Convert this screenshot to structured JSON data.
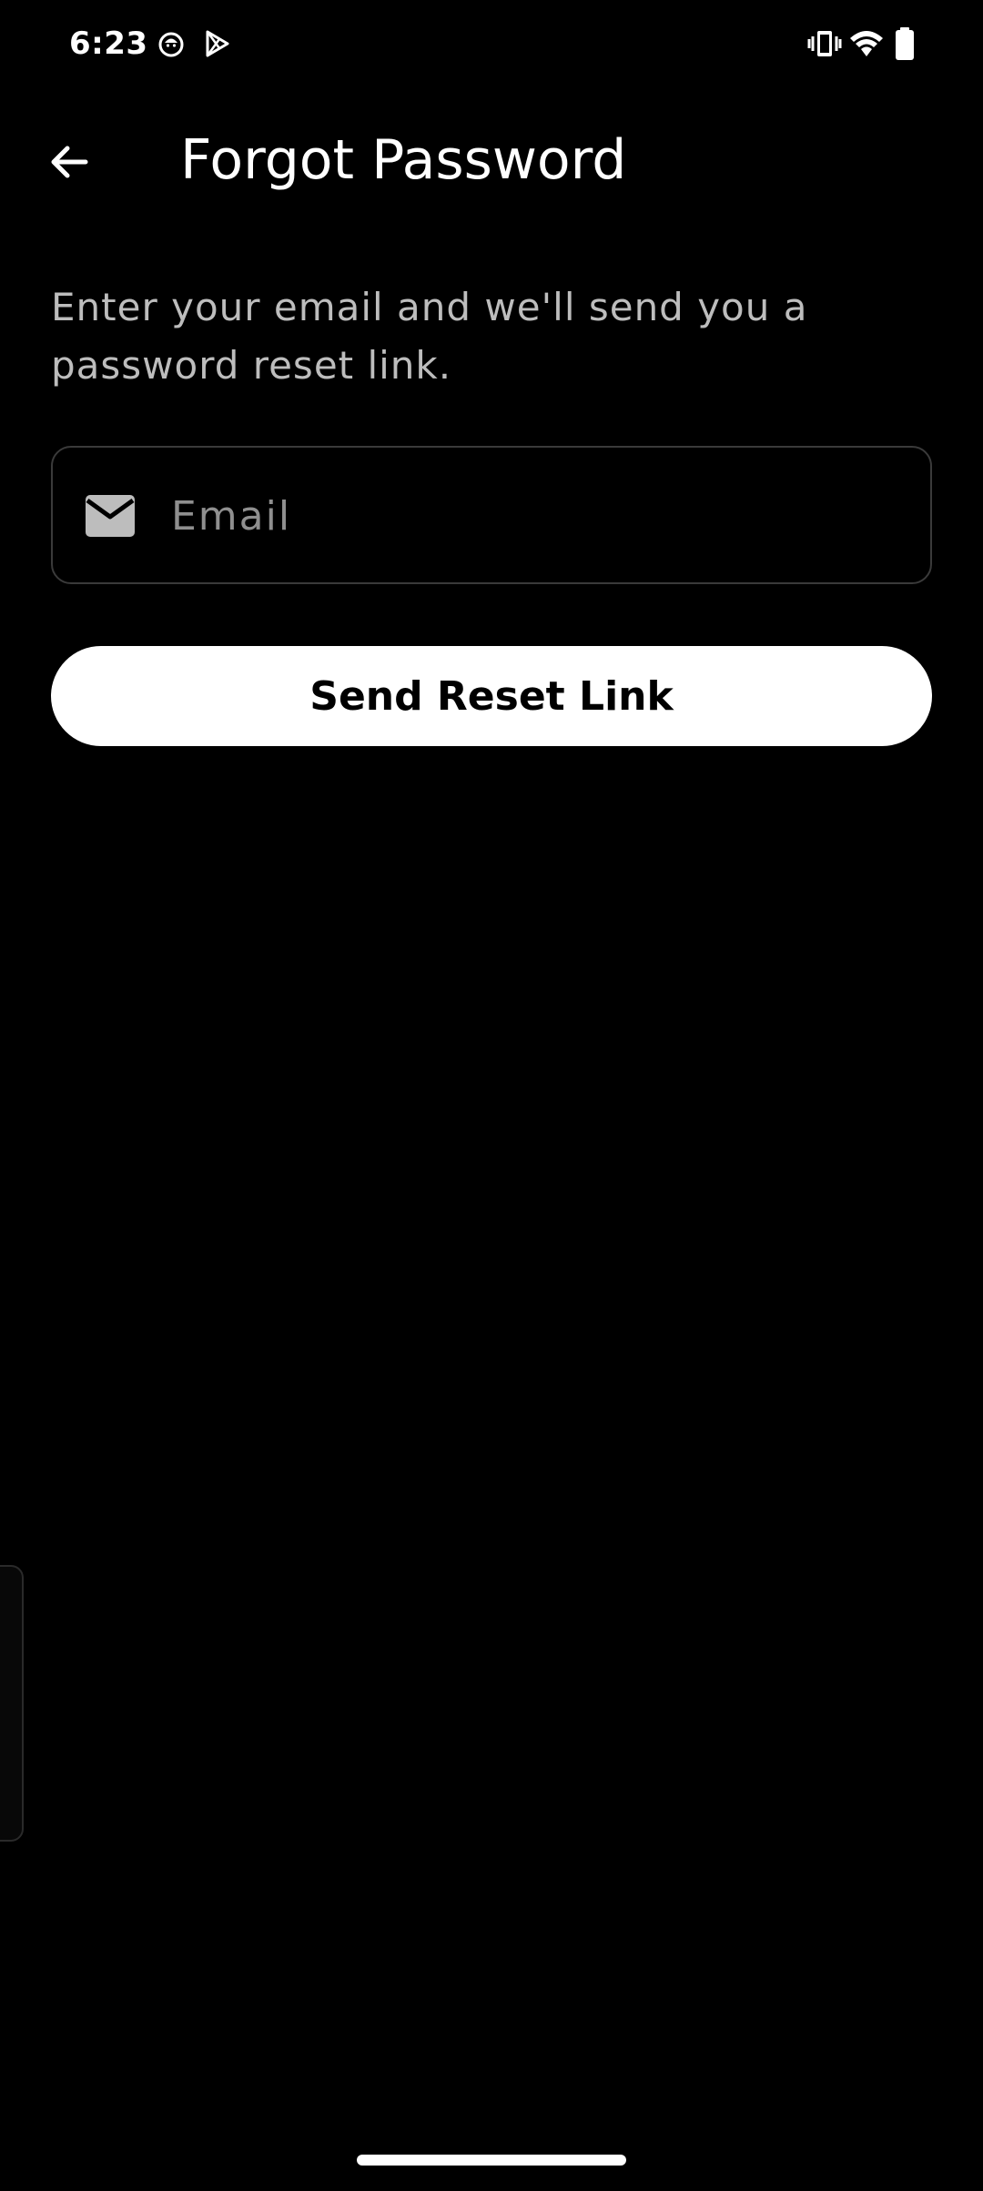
{
  "status_bar": {
    "time": "6:23",
    "notification_icons": [
      "app-notification-icon",
      "play-store-icon"
    ],
    "system_icons": [
      "vibrate-icon",
      "wifi-icon",
      "battery-icon"
    ]
  },
  "app_bar": {
    "back_icon": "arrow-left-icon",
    "title": "Forgot Password"
  },
  "content": {
    "description": "Enter your email and we'll send you a password reset link.",
    "email_field": {
      "icon": "mail-icon",
      "placeholder": "Email",
      "value": ""
    },
    "submit_button": {
      "label": "Send Reset Link"
    }
  },
  "colors": {
    "background": "#000000",
    "text_primary": "#ffffff",
    "text_secondary": "#bdbdbd",
    "placeholder": "#8f8f8f",
    "field_border": "#3a3a3a",
    "button_bg": "#ffffff",
    "button_text": "#000000"
  }
}
